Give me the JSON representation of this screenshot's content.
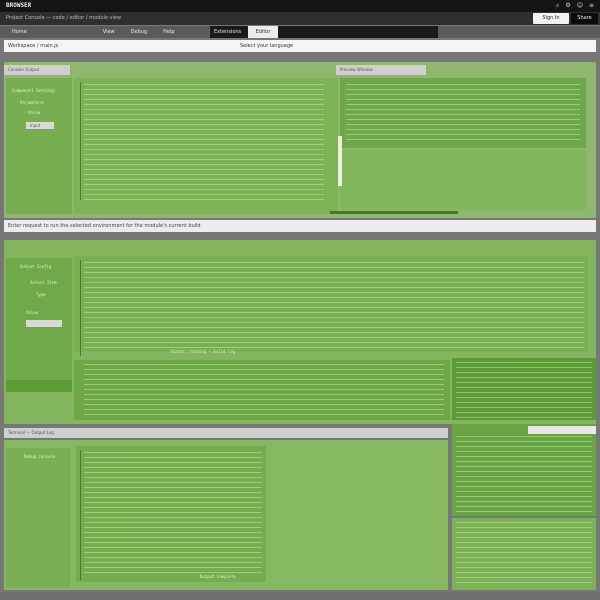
{
  "topbar": {
    "brand": "BROWSER",
    "crumbs": "Project  Console  —  code / editor / module view",
    "signin_label": "Sign In",
    "share_label": "Share",
    "icons": [
      "search-icon",
      "settings-icon",
      "user-icon",
      "menu-icon"
    ]
  },
  "nav": {
    "tabs": [
      "Home",
      "View",
      "Debug",
      "Help"
    ],
    "dark_tab": "Extensions",
    "active_tab": "Editor"
  },
  "pathbar": {
    "path": "Workspace / main.js",
    "center": "Select your language"
  },
  "panel1": {
    "header_left": "Console Output",
    "header_right": "Preview Window",
    "side_labels": [
      "Component Settings",
      "Parameters",
      "Value"
    ],
    "side_input": "Input"
  },
  "banner": {
    "text": "Enter request to run the selected environment for the module's current build"
  },
  "panel2": {
    "side_labels": [
      "Output Config",
      "Select Item",
      "Type",
      "Value"
    ],
    "footer": "Status: running — build log"
  },
  "panel3": {
    "header": "Terminal — Output Log",
    "side_label": "Debug Console",
    "footer": "Output Complete"
  },
  "colors": {
    "green_main": "#76ad4e",
    "green_dark": "#5a9435",
    "topbar": "#141414"
  }
}
